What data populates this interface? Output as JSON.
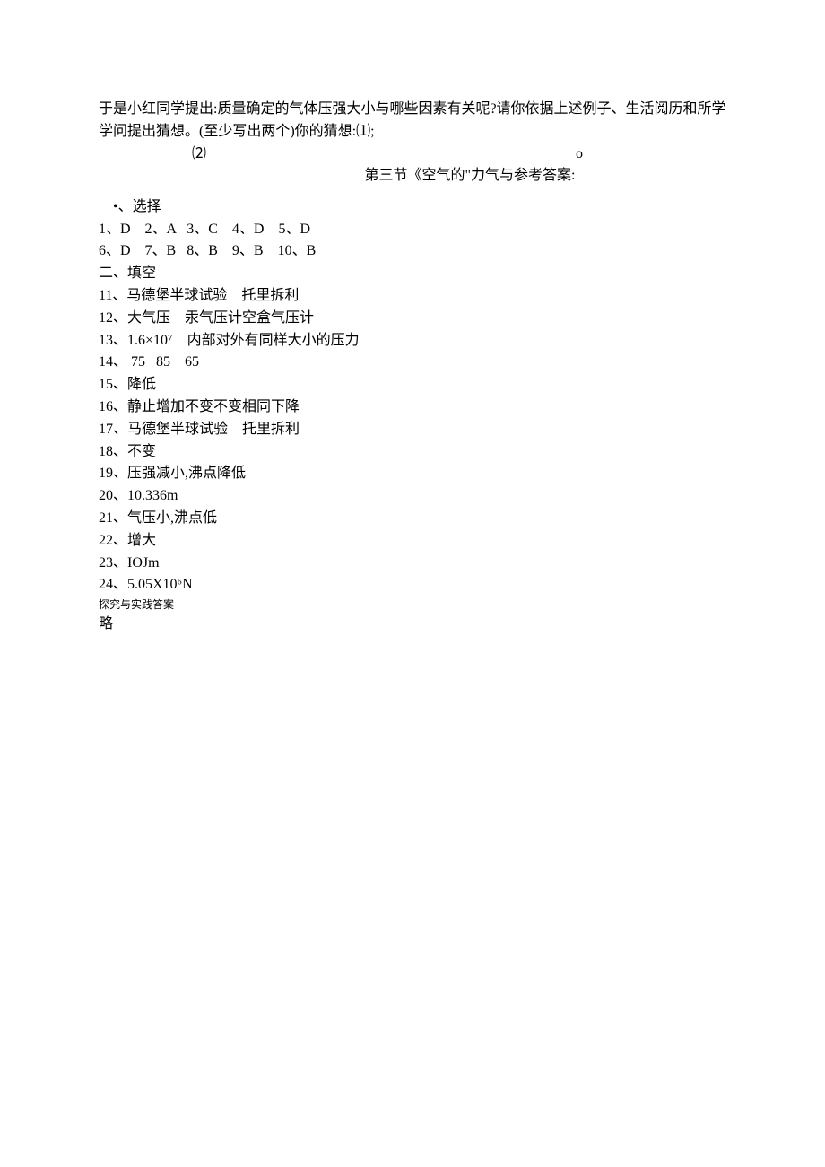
{
  "intro": {
    "line1": "于是小红同学提出:质量确定的气体压强大小与哪些因素有关呢?请你依据上述例子、生活阅历和所学",
    "line2": "学问提出猜想。(至少写出两个)你的猜想:⑴;",
    "line3_label": "⑵",
    "line3_trail": "o"
  },
  "title": "第三节《空气的\"力气与参考答案:",
  "sections": {
    "choose_head": " •、选择",
    "choose_row1": "1、D    2、A   3、C    4、D    5、D",
    "choose_row2": "6、D    7、B   8、B    9、B    10、B",
    "fill_head": "二、填空",
    "a11": "11、马德堡半球试验    托里拆利",
    "a12": "12、大气压    汞气压计空盒气压计",
    "a13": "13、1.6×10⁷    内部对外有同样大小的压力",
    "a14": "14、 75   85    65",
    "a15": "15、降低",
    "a16": "16、静止增加不变不变相同下降",
    "a17": "17、马德堡半球试验    托里拆利",
    "a18": "18、不变",
    "a19": "19、压强减小,沸点降低",
    "a20": "20、10.336m",
    "a21": "21、气压小,沸点低",
    "a22": "22、增大",
    "a23": "23、IOJm",
    "a24": "24、5.05X10⁶N",
    "explore": "探究与实践答案",
    "omit": "略"
  }
}
